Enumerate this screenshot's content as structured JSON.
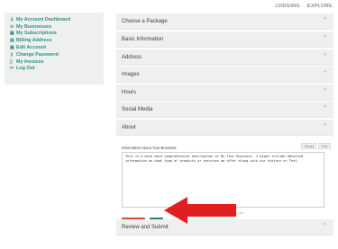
{
  "topnav": {
    "lodging": "LODGING",
    "explore": "EXPLORE"
  },
  "sidebar": {
    "items": [
      {
        "label": "My Account Dashboard",
        "icon": "dashboard-icon",
        "glyph": "♙"
      },
      {
        "label": "My Businesses",
        "icon": "location-icon",
        "glyph": "⊙"
      },
      {
        "label": "My Subscriptions",
        "icon": "subscriptions-icon",
        "glyph": "▦"
      },
      {
        "label": "Billing Address",
        "icon": "billing-icon",
        "glyph": "▤"
      },
      {
        "label": "Edit Account",
        "icon": "edit-account-icon",
        "glyph": "▣"
      },
      {
        "label": "Change Password",
        "icon": "key-icon",
        "glyph": "⚷"
      },
      {
        "label": "My Invoices",
        "icon": "invoices-icon",
        "glyph": "▯"
      },
      {
        "label": "Log Out",
        "icon": "logout-icon",
        "glyph": "↦"
      }
    ]
  },
  "sections": [
    {
      "name": "choose-package",
      "label": "Choose a Package"
    },
    {
      "name": "basic-information",
      "label": "Basic Information"
    },
    {
      "name": "address",
      "label": "Address"
    },
    {
      "name": "images",
      "label": "Images"
    },
    {
      "name": "hours",
      "label": "Hours"
    },
    {
      "name": "social-media",
      "label": "Social Media"
    },
    {
      "name": "about",
      "label": "About"
    },
    {
      "name": "review-and-submit",
      "label": "Review and Submit"
    }
  ],
  "about": {
    "field_label": "Information About Your Business",
    "visual_tab": "Visual",
    "text_tab": "Text",
    "content": "This is a much more comprehensive description of My Test Business. I might include detailed information on what type of products or services we offer along with our history or Test.",
    "helper": "Information here can be formatted and detailed by our staff.",
    "previous_label": "Previous",
    "next_label": "Next"
  },
  "colors": {
    "accent": "#2f8f86",
    "previous_button": "#c8572f",
    "next_button": "#2f7d73",
    "arrow": "#e02020",
    "panel_background": "#eef0ee"
  }
}
